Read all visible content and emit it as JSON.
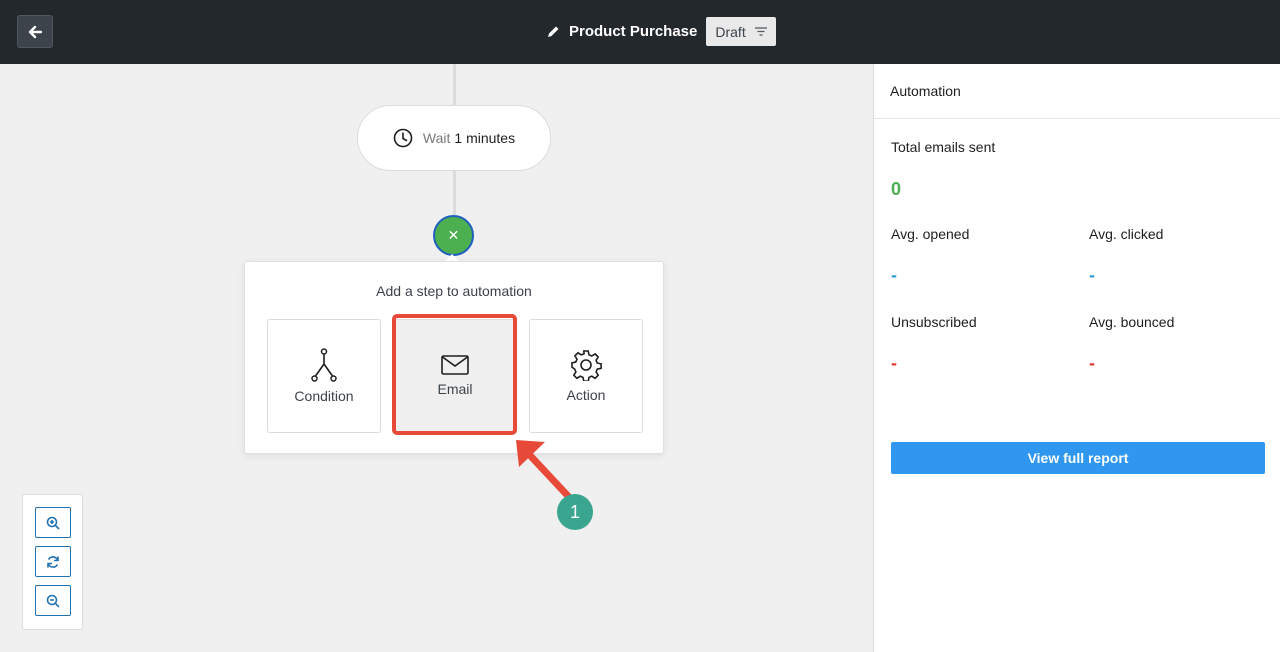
{
  "header": {
    "title": "Product Purchase",
    "status": "Draft"
  },
  "canvas": {
    "wait_word": "Wait",
    "wait_value": "1 minutes",
    "popup_title": "Add a step to automation",
    "steps": [
      {
        "label": "Condition",
        "icon": "branch-icon"
      },
      {
        "label": "Email",
        "icon": "envelope-icon"
      },
      {
        "label": "Action",
        "icon": "gear-icon"
      }
    ],
    "annotation_number": "1",
    "highlight_color": "#e84a3a",
    "badge_color": "#3aa68f"
  },
  "panel": {
    "title": "Automation",
    "total_label": "Total emails sent",
    "total_value": "0",
    "opened_label": "Avg. opened",
    "opened_value": "-",
    "clicked_label": "Avg. clicked",
    "clicked_value": "-",
    "unsub_label": "Unsubscribed",
    "unsub_value": "-",
    "bounced_label": "Avg. bounced",
    "bounced_value": "-",
    "report_button": "View full report",
    "accent": "#2f97f0"
  }
}
